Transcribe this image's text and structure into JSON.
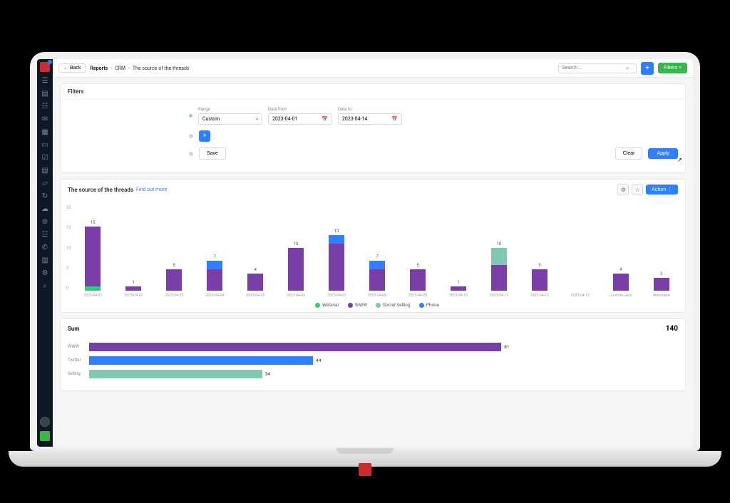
{
  "topbar": {
    "back": "← Back",
    "breadcrumb_root": "Reports",
    "breadcrumb_level1": "CRM",
    "breadcrumb_level2": "The source of the threads",
    "search_placeholder": "Search...",
    "filters_button": "Filters ˅"
  },
  "filters_card": {
    "title": "Filters",
    "range_label": "Range",
    "range_value": "Custom",
    "date_from_label": "Data from",
    "date_from_value": "2023-04-01",
    "date_to_label": "Data to",
    "date_to_value": "2023-04-14",
    "save": "Save",
    "clear": "Clear",
    "apply": "Apply"
  },
  "chart_card": {
    "title": "The source of the threads",
    "find_out_more": "Find out more",
    "action": "Action ⋮"
  },
  "chart_data": {
    "type": "bar",
    "title": "The source of the threads",
    "xlabel": "",
    "ylabel": "",
    "ylim": [
      0,
      20
    ],
    "yticks": [
      0,
      5,
      10,
      15,
      20
    ],
    "categories": [
      "2023-04-01",
      "2023-04-02",
      "2023-04-03",
      "2023-04-04",
      "2023-04-05",
      "2023-04-06",
      "2023-04-07",
      "2023-04-08",
      "2023-04-09",
      "2023-04-10",
      "2023-04-11",
      "2023-04-12",
      "2023-04-13",
      "u.Letnia-Jacu",
      "Warszawa"
    ],
    "totals": [
      15,
      1,
      5,
      7,
      4,
      10,
      13,
      7,
      5,
      1,
      10,
      5,
      null,
      4,
      3
    ],
    "series": [
      {
        "name": "Webinar",
        "color": "#2eca7f",
        "values": [
          1,
          0,
          0,
          0,
          0,
          0,
          0,
          0,
          0,
          0,
          0,
          0,
          0,
          0,
          0
        ]
      },
      {
        "name": "WWW",
        "color": "#7a3ea8",
        "values": [
          14,
          1,
          5,
          5,
          4,
          10,
          11,
          5,
          5,
          1,
          6,
          5,
          0,
          4,
          3
        ]
      },
      {
        "name": "Social Selling",
        "color": "#7fc9b4",
        "values": [
          0,
          0,
          0,
          0,
          0,
          0,
          0,
          0,
          0,
          0,
          4,
          0,
          0,
          0,
          0
        ]
      },
      {
        "name": "Phone",
        "color": "#2f7fff",
        "values": [
          0,
          0,
          0,
          2,
          0,
          0,
          2,
          2,
          0,
          0,
          0,
          0,
          0,
          0,
          0
        ]
      }
    ]
  },
  "sum_card": {
    "title": "Sum",
    "total": "140",
    "type": "bar",
    "orientation": "horizontal",
    "rows": [
      {
        "label": "WWW",
        "value": 81,
        "color": "#7a3ea8"
      },
      {
        "label": "Twitter",
        "value": 44,
        "color": "#2f7fff"
      },
      {
        "label": "Selling",
        "value": 34,
        "color": "#7fc9b4"
      }
    ]
  },
  "colors": {
    "webinar": "#2eca7f",
    "www": "#7a3ea8",
    "social": "#7fc9b4",
    "phone": "#2f7fff",
    "accent": "#2f7fff",
    "success": "#3bb54a"
  }
}
